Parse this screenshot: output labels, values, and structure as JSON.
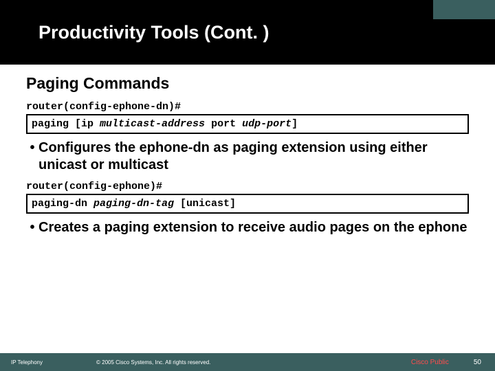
{
  "header": {
    "title": "Productivity Tools (Cont. )"
  },
  "section": {
    "subtitle": "Paging Commands"
  },
  "block1": {
    "prompt": "router(config-ephone-dn)#",
    "cmd_prefix": "paging [ip ",
    "cmd_arg1": "multicast-address",
    "cmd_mid": " port ",
    "cmd_arg2": "udp-port",
    "cmd_suffix": "]",
    "bullet": "Configures the ephone-dn as paging extension using either unicast or multicast"
  },
  "block2": {
    "prompt": "router(config-ephone)#",
    "cmd_prefix": "paging-dn ",
    "cmd_arg1": "paging-dn-tag",
    "cmd_suffix": " [unicast]",
    "bullet": "Creates a paging extension to receive audio pages on the ephone"
  },
  "footer": {
    "left": "IP Telephony",
    "center": "© 2005 Cisco Systems, Inc. All rights reserved.",
    "public_label": "Cisco Public",
    "page": "50"
  }
}
